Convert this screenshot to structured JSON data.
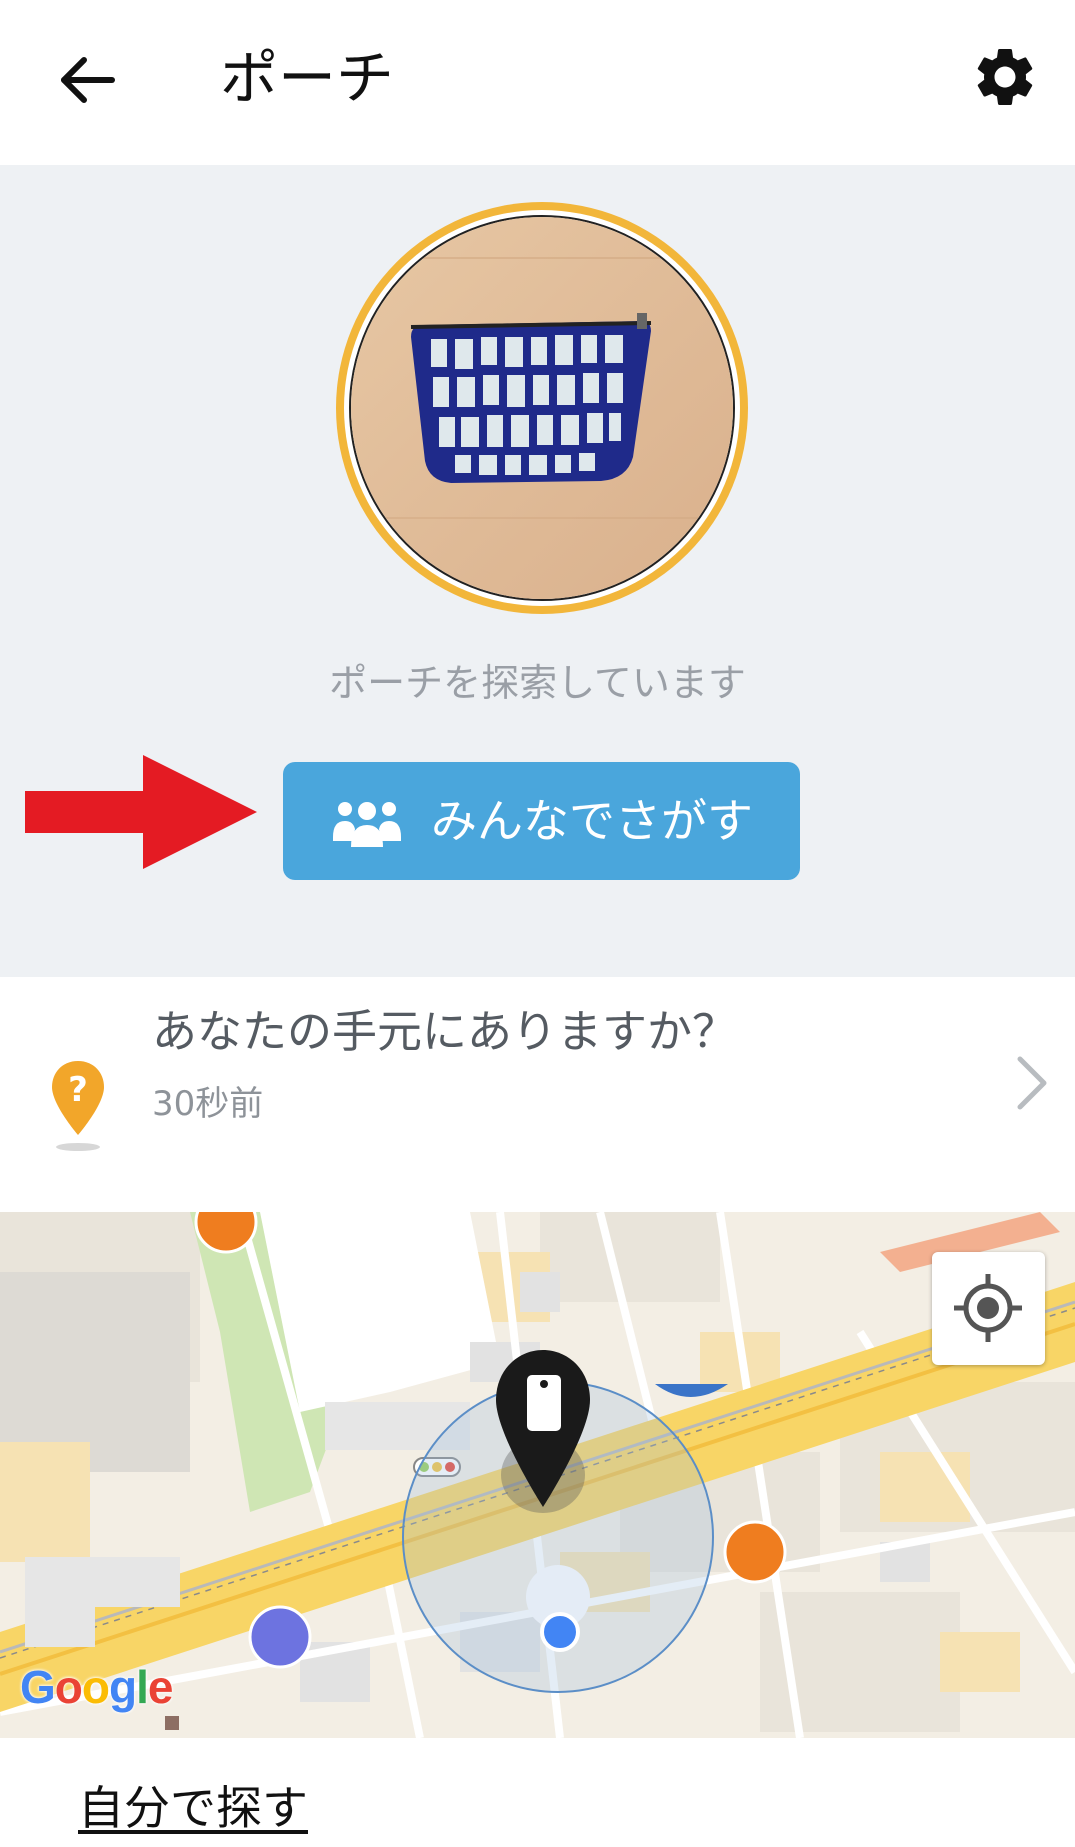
{
  "header": {
    "title": "ポーチ",
    "back_icon": "arrow-left-icon",
    "settings_icon": "gear-icon"
  },
  "item": {
    "photo_subject": "blue-white grid pouch",
    "ring_color": "#f2b63a",
    "status": "ポーチを探索しています"
  },
  "share_button": {
    "label": "みんなでさがす",
    "icon": "people-group-icon",
    "color": "#4aa6dc"
  },
  "notice": {
    "title": "あなたの手元にありますか？",
    "time": "30秒前",
    "icon": "question-pin-icon",
    "pin_color": "#f2a62a"
  },
  "map": {
    "provider_logo": "Google",
    "locate_icon": "crosshair-icon",
    "tag_marker_icon": "tag-pin-icon"
  },
  "footer": {
    "link_label": "自分で探す"
  }
}
